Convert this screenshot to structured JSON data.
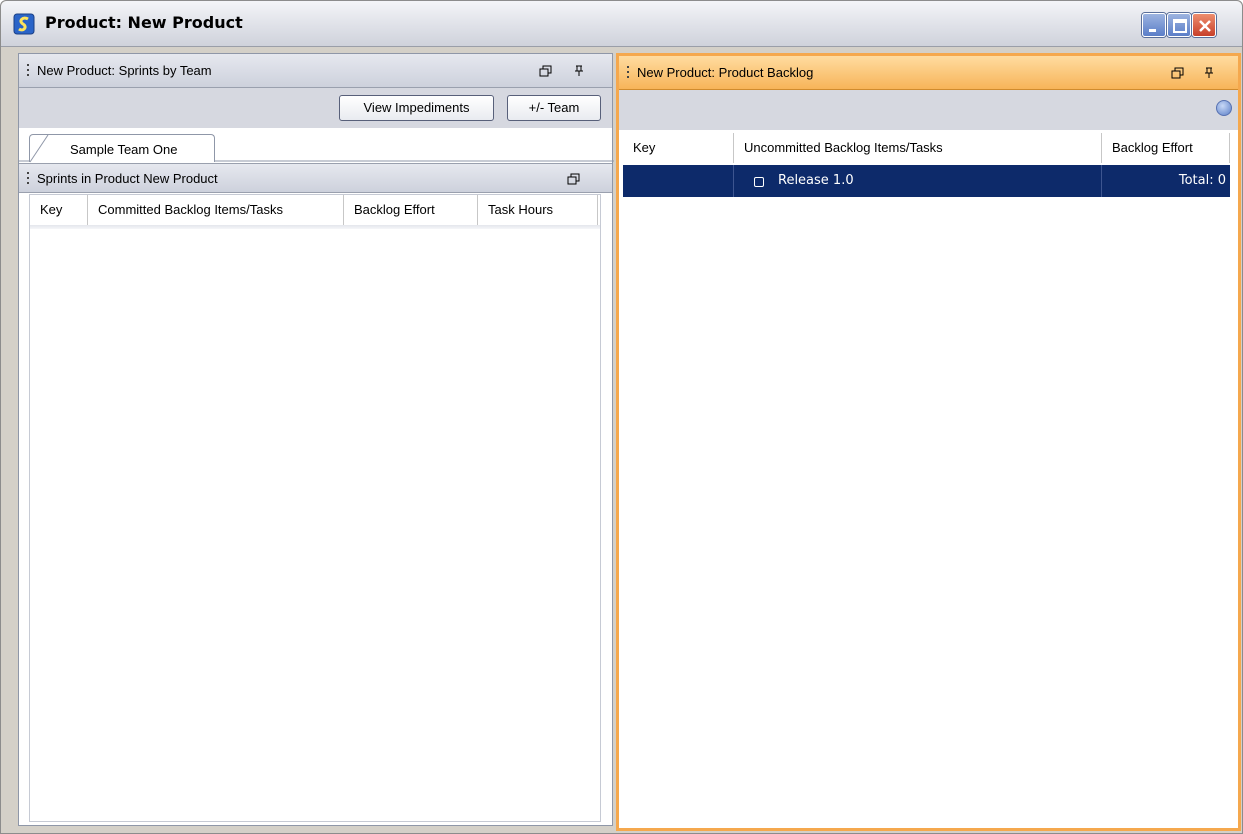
{
  "window": {
    "title": "Product: New Product",
    "icon": "app-icon"
  },
  "left_panel": {
    "title": "New Product: Sprints by Team",
    "toolbar": {
      "view_impediments_label": "View Impediments",
      "team_label": "+/- Team"
    },
    "tabs": [
      {
        "label": "Sample Team One",
        "selected": true
      }
    ],
    "subpanel": {
      "title": "Sprints in Product New Product",
      "columns": [
        "Key",
        "Committed Backlog Items/Tasks",
        "Backlog Effort",
        "Task Hours"
      ],
      "rows": []
    }
  },
  "right_panel": {
    "title": "New Product: Product Backlog",
    "help_icon": "help-icon",
    "columns": [
      "Key",
      "Uncommitted Backlog Items/Tasks",
      "Backlog Effort"
    ],
    "rows": [
      {
        "key": "",
        "item": "Release 1.0",
        "effort": "Total: 0",
        "selected": true
      }
    ]
  },
  "colors": {
    "active_panel_border": "#f5a84d",
    "selected_row": "#0d2a6a"
  }
}
